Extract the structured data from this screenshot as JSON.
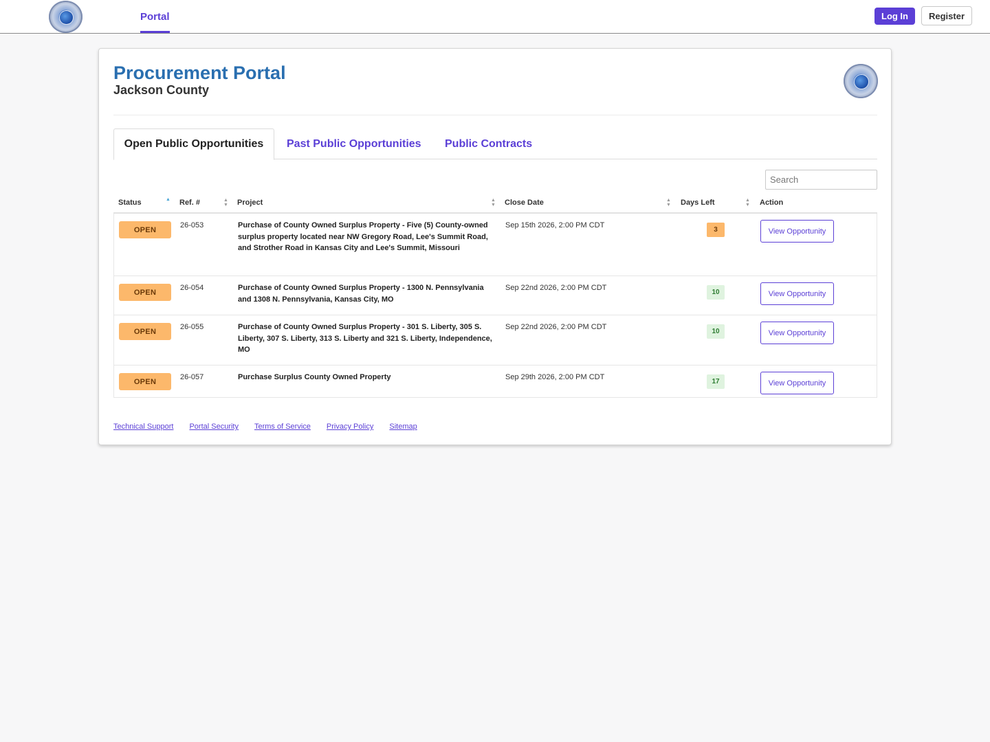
{
  "nav": {
    "portal_label": "Portal",
    "login_label": "Log In",
    "register_label": "Register",
    "logo_icon": "county-seal-icon"
  },
  "header": {
    "title": "Procurement Portal",
    "subtitle": "Jackson County"
  },
  "tabs": [
    {
      "label": "Open Public Opportunities",
      "active": true
    },
    {
      "label": "Past Public Opportunities",
      "active": false
    },
    {
      "label": "Public Contracts",
      "active": false
    }
  ],
  "search": {
    "placeholder": "Search",
    "value": ""
  },
  "table": {
    "columns": [
      {
        "label": "Status",
        "sort": "asc"
      },
      {
        "label": "Ref. #",
        "sort": "none"
      },
      {
        "label": "Project",
        "sort": "none"
      },
      {
        "label": "Close Date",
        "sort": "none"
      },
      {
        "label": "Days Left",
        "sort": "none"
      },
      {
        "label": "Action",
        "sort": null
      }
    ],
    "rows": [
      {
        "status": "OPEN",
        "ref": "26-053",
        "project": "Purchase of County Owned Surplus Property - Five (5) County-owned surplus property located near NW Gregory Road, Lee's Summit Road, and Strother Road in Kansas City and Lee's Summit, Missouri",
        "close_date": "Sep 15th 2026, 2:00 PM CDT",
        "days_left": "3",
        "action": "View Opportunity"
      },
      {
        "status": "OPEN",
        "ref": "26-054",
        "project": "Purchase of County Owned Surplus Property - 1300 N. Pennsylvania and 1308 N. Pennsylvania, Kansas City, MO",
        "close_date": "Sep 22nd 2026, 2:00 PM CDT",
        "days_left": "10",
        "action": "View Opportunity"
      },
      {
        "status": "OPEN",
        "ref": "26-055",
        "project": "Purchase of County Owned Surplus Property - 301 S. Liberty, 305 S. Liberty, 307 S. Liberty, 313 S. Liberty and 321 S. Liberty, Independence, MO",
        "close_date": "Sep 22nd 2026, 2:00 PM CDT",
        "days_left": "10",
        "action": "View Opportunity"
      },
      {
        "status": "OPEN",
        "ref": "26-057",
        "project": "Purchase Surplus County Owned Property",
        "close_date": "Sep 29th 2026, 2:00 PM CDT",
        "days_left": "17",
        "action": "View Opportunity"
      }
    ]
  },
  "footer": {
    "links": [
      "Technical Support",
      "Portal Security",
      "Terms of Service",
      "Privacy Policy",
      "Sitemap"
    ]
  },
  "colors": {
    "accent": "#5b3fd6",
    "title_blue": "#2a6fb0",
    "status_open": "#fcb86b",
    "days_ok": "#dff3df"
  }
}
